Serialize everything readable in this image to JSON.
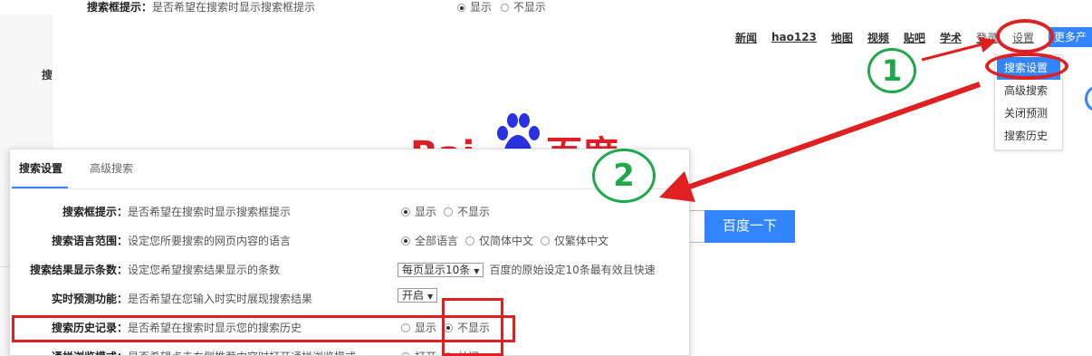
{
  "background_row": {
    "label": "搜索框提示：",
    "desc": "是否希望在搜索时显示搜索框提示",
    "options": [
      "显示",
      "不显示"
    ]
  },
  "background_left_ghost": "搜",
  "top_nav": {
    "links": [
      "新闻",
      "hao123",
      "地图",
      "视频",
      "贴吧",
      "学术"
    ],
    "login": "登录",
    "settings": "设置",
    "more": "更多产"
  },
  "settings_menu": {
    "items": [
      "搜索设置",
      "高级搜索",
      "关闭预测",
      "搜索历史"
    ]
  },
  "logo": {
    "text_left": "Bai",
    "text_right": "百度"
  },
  "search_button": "百度一下",
  "panel": {
    "tabs": [
      "搜索设置",
      "高级搜索"
    ],
    "rows": [
      {
        "label": "搜索框提示：",
        "desc": "是否希望在搜索时显示搜索框提示",
        "type": "radio",
        "options": [
          "显示",
          "不显示"
        ],
        "selected": 0
      },
      {
        "label": "搜索语言范围：",
        "desc": "设定您所要搜索的网页内容的语言",
        "type": "radio",
        "options": [
          "全部语言",
          "仅简体中文",
          "仅繁体中文"
        ],
        "selected": 0
      },
      {
        "label": "搜索结果显示条数：",
        "desc": "设定您希望搜索结果显示的条数",
        "type": "select",
        "value": "每页显示10条",
        "note": "百度的原始设定10条最有效且快速"
      },
      {
        "label": "实时预测功能：",
        "desc": "是否希望在您输入时实时展现搜索结果",
        "type": "select",
        "value": "开启",
        "note": ""
      },
      {
        "label": "搜索历史记录：",
        "desc": "是否希望在搜索时显示您的搜索历史",
        "type": "radio",
        "options": [
          "显示",
          "不显示"
        ],
        "selected": 1
      },
      {
        "label": "通栏浏览模式：",
        "desc": "是否希望点击右侧推荐内容时打开通栏浏览模式",
        "type": "radio",
        "options": [
          "打开",
          "关闭"
        ],
        "selected": 0
      }
    ]
  },
  "annotations": {
    "step1": "1",
    "step2": "2",
    "highlight_color": "#e02020",
    "step_color": "#1fa84a"
  },
  "colors": {
    "accent": "#3385ff",
    "logo_red": "#de1f26",
    "paw_blue": "#2932e1"
  }
}
